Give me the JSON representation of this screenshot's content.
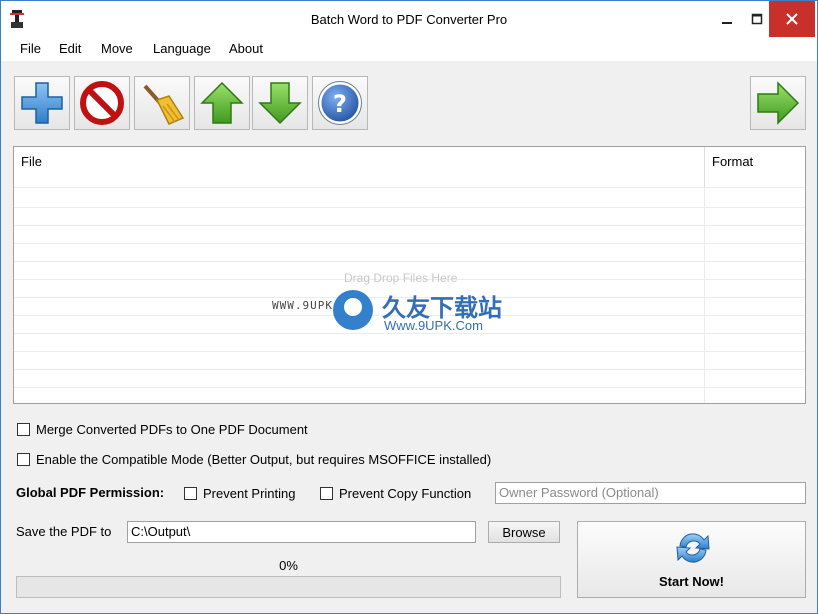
{
  "window": {
    "title": "Batch Word to PDF Converter Pro"
  },
  "menu": {
    "items": [
      "File",
      "Edit",
      "Move",
      "Language",
      "About"
    ]
  },
  "toolbar": {
    "buttons": [
      "add-icon",
      "remove-icon",
      "clear-icon",
      "move-up-icon",
      "move-down-icon",
      "help-icon"
    ],
    "convert": "arrow-right-icon"
  },
  "filelist": {
    "columns": [
      "File",
      "Format"
    ],
    "drop_hint": "Drag  Drop Files Here"
  },
  "watermark": {
    "left_text": "WWW.9UPK.COM",
    "cn_text": "久友下载站",
    "url_text": "Www.9UPK.Com"
  },
  "options": {
    "merge_label": "Merge Converted PDFs to One PDF Document",
    "merge_checked": false,
    "compat_label": "Enable the Compatible Mode (Better Output, but requires MSOFFICE installed)",
    "compat_checked": false
  },
  "permission": {
    "label": "Global PDF Permission:",
    "prevent_printing": "Prevent Printing",
    "prevent_printing_checked": false,
    "prevent_copy": "Prevent Copy Function",
    "prevent_copy_checked": false,
    "owner_password_placeholder": "Owner Password (Optional)"
  },
  "save": {
    "label": "Save the PDF to",
    "path": "C:\\Output\\",
    "browse_label": "Browse"
  },
  "progress": {
    "text": "0%",
    "value": 0
  },
  "start": {
    "label": "Start Now!"
  },
  "colors": {
    "accent_border": "#3b7fc4",
    "close_button": "#c7302b",
    "green_arrow": "#4caf2b"
  }
}
